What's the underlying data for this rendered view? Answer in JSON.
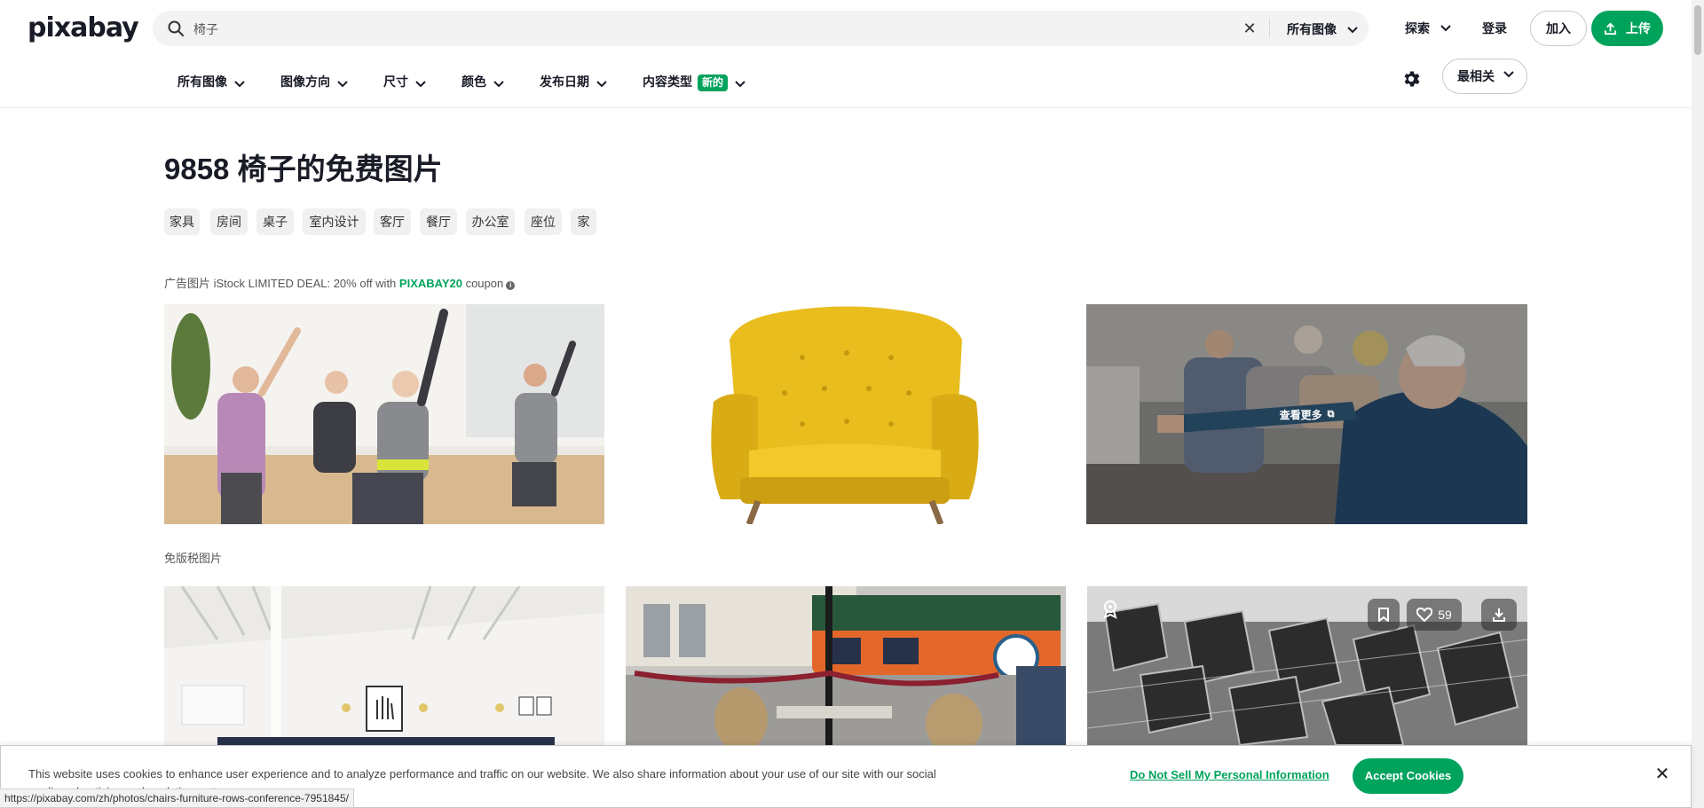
{
  "header": {
    "logo": "pixabay",
    "search": {
      "value": "椅子",
      "filter_label": "所有图像"
    },
    "nav": {
      "explore": "探索",
      "login": "登录",
      "join": "加入",
      "upload": "上传"
    }
  },
  "filters": {
    "items": [
      {
        "label": "所有图像"
      },
      {
        "label": "图像方向"
      },
      {
        "label": "尺寸"
      },
      {
        "label": "颜色"
      },
      {
        "label": "发布日期"
      },
      {
        "label": "内容类型",
        "badge": "新的"
      }
    ],
    "sort": "最相关"
  },
  "main": {
    "title": "9858 椅子的免费图片",
    "tags": [
      "家具",
      "房间",
      "桌子",
      "室内设计",
      "客厅",
      "餐厅",
      "办公室",
      "座位",
      "家"
    ],
    "ad": {
      "prefix": "广告图片 iStock LIMITED DEAL: 20% off with ",
      "code": "PIXABAY20",
      "suffix": " coupon"
    },
    "see_more": "查看更多",
    "section_label": "免版税图片",
    "likes": "59"
  },
  "cookie": {
    "text": "This website uses cookies to enhance user experience and to analyze performance and traffic on our website. We also share information about your use of our site with our social media, advertising and analytics partners.",
    "do_not_sell": "Do Not Sell My Personal Information",
    "accept": "Accept Cookies"
  },
  "status_url": "https://pixabay.com/zh/photos/chairs-furniture-rows-conference-7951845/",
  "colors": {
    "brand_green": "#00a35c",
    "text": "#191b26",
    "chip_bg": "#f0f0f0",
    "chair_yellow": "#e8bd20"
  }
}
